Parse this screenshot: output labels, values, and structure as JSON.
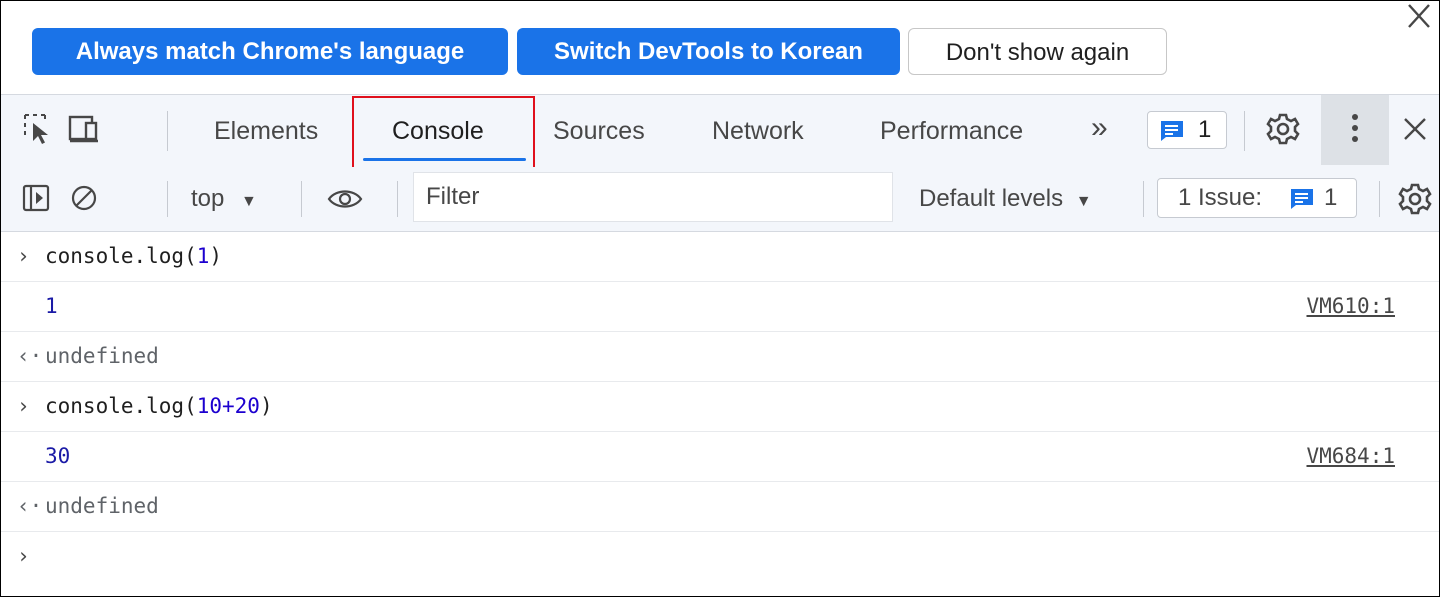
{
  "infobar": {
    "always_match": "Always match Chrome's language",
    "switch_korean": "Switch DevTools to Korean",
    "dont_show": "Don't show again"
  },
  "tabs": {
    "elements": "Elements",
    "console": "Console",
    "sources": "Sources",
    "network": "Network",
    "performance": "Performance",
    "more": "»",
    "messages_count": "1"
  },
  "console_toolbar": {
    "context": "top",
    "filter_placeholder": "Filter",
    "levels": "Default levels",
    "issues_label": "1 Issue:",
    "issues_count": "1"
  },
  "console": {
    "rows": [
      {
        "type": "input",
        "code_prefix": "console.log(",
        "code_arg": "1",
        "code_suffix": ")"
      },
      {
        "type": "output",
        "value": "1",
        "source": "VM610:1"
      },
      {
        "type": "result",
        "value": "undefined"
      },
      {
        "type": "input",
        "code_prefix": "console.log(",
        "code_arg": "10+20",
        "code_suffix": ")"
      },
      {
        "type": "output",
        "value": "30",
        "source": "VM684:1"
      },
      {
        "type": "result",
        "value": "undefined"
      }
    ]
  },
  "colors": {
    "accent": "#1a73e8",
    "highlight_box": "#e0101c"
  }
}
